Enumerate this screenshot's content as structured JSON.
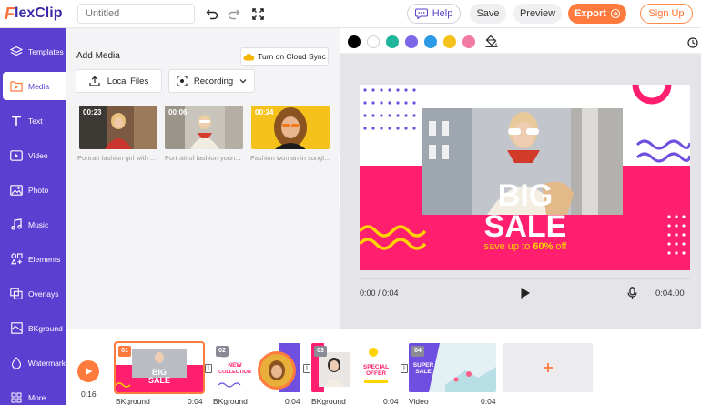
{
  "header": {
    "logo_mark": "F",
    "logo_text": "lexClip",
    "title_placeholder": "Untitled",
    "help_label": "Help",
    "save_label": "Save",
    "preview_label": "Preview",
    "export_label": "Export",
    "signup_label": "Sign Up"
  },
  "sidebar": {
    "items": [
      {
        "label": "Templates",
        "icon": "layers-icon"
      },
      {
        "label": "Media",
        "icon": "media-folder-icon"
      },
      {
        "label": "Text",
        "icon": "text-icon"
      },
      {
        "label": "Video",
        "icon": "video-icon"
      },
      {
        "label": "Photo",
        "icon": "photo-icon"
      },
      {
        "label": "Music",
        "icon": "music-icon"
      },
      {
        "label": "Elements",
        "icon": "elements-icon"
      },
      {
        "label": "Overlays",
        "icon": "overlays-icon"
      },
      {
        "label": "BKground",
        "icon": "background-icon"
      },
      {
        "label": "Watermark",
        "icon": "watermark-icon"
      },
      {
        "label": "More",
        "icon": "more-icon"
      }
    ],
    "active": "Media"
  },
  "media_panel": {
    "title": "Add Media",
    "cloud_sync_label": "Turn on Cloud Sync",
    "local_files_label": "Local Files",
    "recording_label": "Recording",
    "items": [
      {
        "duration": "00:23",
        "caption": "Portrait fashion girl with ..."
      },
      {
        "duration": "00:06",
        "caption": "Portrait of fashion youn..."
      },
      {
        "duration": "00:24",
        "caption": "Fashion woman in sungl..."
      }
    ]
  },
  "swatches": [
    "#000000",
    "#ffffff",
    "#1fb59a",
    "#7b68e8",
    "#2c9be6",
    "#f5c21b",
    "#f27ba3"
  ],
  "preview": {
    "headline_1": "BIG",
    "headline_2": "SALE",
    "subline_pre": "save up to ",
    "subline_pct": "60%",
    "subline_post": " off"
  },
  "player": {
    "current_time": "0:00 / 0:04",
    "total_time": "0:04.00"
  },
  "timeline": {
    "time": "0:16",
    "clips": [
      {
        "num": "01",
        "label": "BKground",
        "duration": "0:04",
        "title_1": "BIG",
        "title_2": "SALE"
      },
      {
        "num": "02",
        "label": "BKground",
        "duration": "0:04",
        "title_1": "NEW",
        "title_2": "COLLECTION"
      },
      {
        "num": "03",
        "label": "BKground",
        "duration": "0:04",
        "title_1": "SPECIAL",
        "title_2": "OFFER"
      },
      {
        "num": "04",
        "label": "Video",
        "duration": "0:04",
        "title_1": "SUPER",
        "title_2": "SALE"
      }
    ]
  },
  "colors": {
    "brand_purple": "#5a3fd1",
    "accent_orange": "#ff7a3d",
    "sale_pink": "#ff1f6e",
    "sale_yellow": "#ffd400"
  }
}
